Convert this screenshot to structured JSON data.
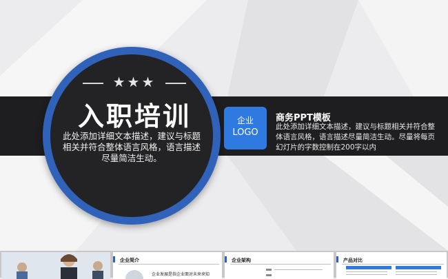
{
  "hero": {
    "title": "入职培训",
    "description": "此处添加详细文本描述，建议与标题相关并符合整体语言风格，语言描述尽量简洁生动。",
    "stars": "★★★"
  },
  "logo": {
    "line1": "企业",
    "line2": "LOGO"
  },
  "template": {
    "title": "商务PPT模板",
    "description": "此处添加详细文本描述，建议与标题相关并符合整体语言风格，语言描述尽量简洁生动。尽量将每页幻灯片的字数控制在200字以内"
  },
  "thumbnails": [
    {
      "title": "",
      "type": "photo"
    },
    {
      "title": "企业简介",
      "text": "企业发展是指企业面对未来来知"
    },
    {
      "title": "企业架构",
      "text": ""
    },
    {
      "title": "产品对比",
      "text": ""
    }
  ],
  "colors": {
    "accent": "#2f62b8",
    "logo_blue": "#2f7ae0",
    "band": "#1e1e20",
    "background": "#ececee"
  }
}
